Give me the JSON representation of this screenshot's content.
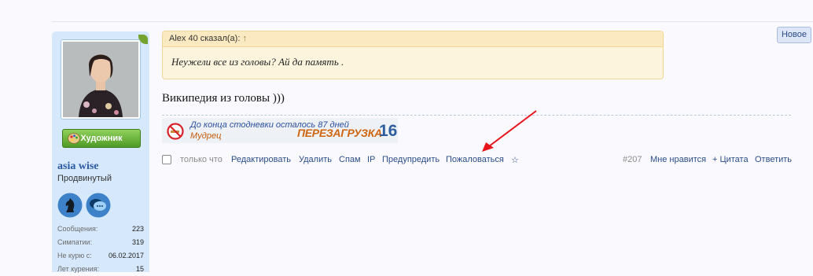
{
  "badge": {
    "new_label": "Новое"
  },
  "sidebar": {
    "role_label": "Художник",
    "user_name": "asia wise",
    "user_title": "Продвинутый",
    "stats": [
      {
        "label": "Сообщения:",
        "value": "223"
      },
      {
        "label": "Симпатии:",
        "value": "319"
      },
      {
        "label": "Не курю с:",
        "value": "06.02.2017"
      },
      {
        "label": "Лет курения:",
        "value": "15"
      }
    ]
  },
  "quote": {
    "author": "Alex 40 сказал(а):",
    "arrow": "↑",
    "text": "Неужели все из головы? Ай да память ."
  },
  "message": {
    "text": "Википедия из головы )))"
  },
  "signature": {
    "line1": "До конца стодневки осталось 87 дней",
    "line2": "Мудрец",
    "brand": "ПЕРЕЗАГРУЗКА",
    "brand_num": "16"
  },
  "actions": {
    "time": "только что",
    "edit": "Редактировать",
    "delete": "Удалить",
    "spam": "Спам",
    "ip": "IP",
    "warn": "Предупредить",
    "report": "Пожаловаться",
    "star": "☆",
    "post_num": "#207",
    "like": "Мне нравится",
    "quote": "+ Цитата",
    "reply": "Ответить"
  },
  "colors": {
    "link": "#2b4c87",
    "arrow": "#e8141b",
    "sidebar": "#d6e8fb",
    "quote_bg": "#fdf4de"
  }
}
